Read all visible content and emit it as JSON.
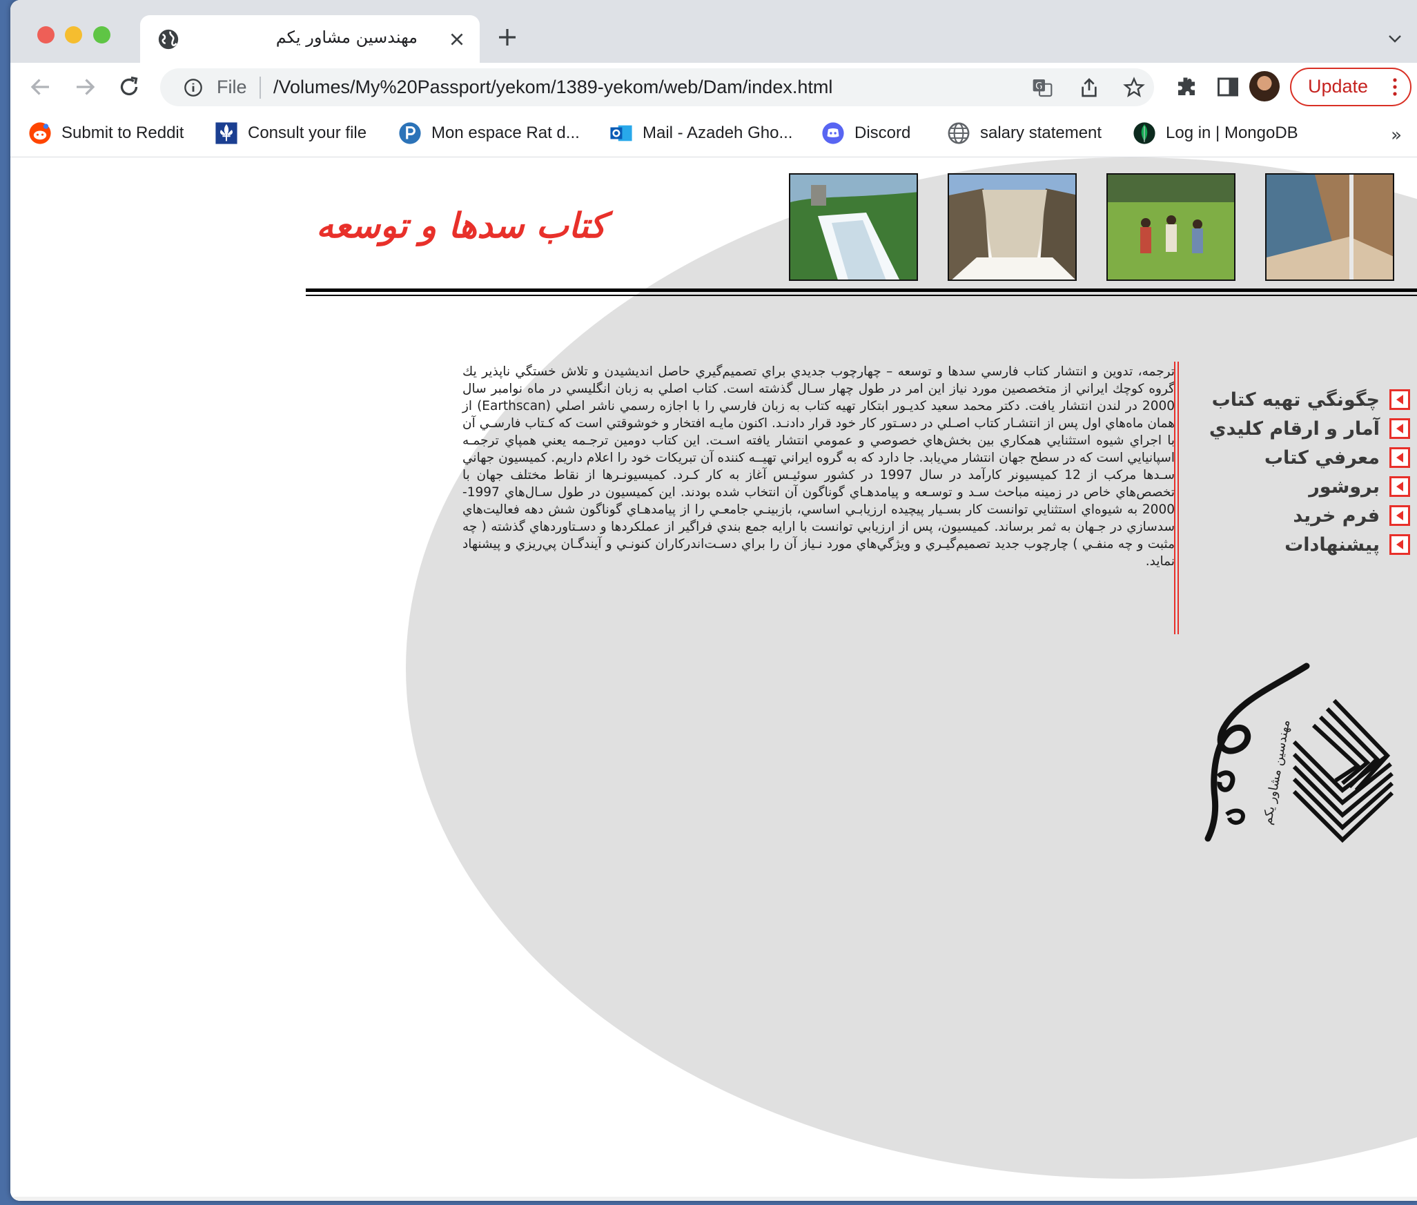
{
  "browser": {
    "tab": {
      "title": "مهندسين مشاور يكم"
    },
    "address_bar": {
      "scheme_label": "File",
      "url": "/Volumes/My%20Passport/yekom/1389-yekom/web/Dam/index.html"
    },
    "update_button": {
      "label": "Update"
    },
    "bookmarks": [
      {
        "label": "Submit to Reddit",
        "icon": "reddit-icon"
      },
      {
        "label": "Consult your file",
        "icon": "fleur-de-lis-icon"
      },
      {
        "label": "Mon espace Rat d...",
        "icon": "p-circle-icon"
      },
      {
        "label": "Mail - Azadeh Gho...",
        "icon": "outlook-icon"
      },
      {
        "label": "Discord",
        "icon": "discord-icon"
      },
      {
        "label": "salary statement",
        "icon": "globe-icon"
      },
      {
        "label": "Log in | MongoDB",
        "icon": "mongodb-leaf-icon"
      }
    ],
    "bookmarks_overflow": "»"
  },
  "page": {
    "title": "كتاب سدها و توسعه",
    "article": "ترجمه، تدوين و انتشار كتاب فارسي سدها و توسعه  –  چهارچوب جديدي براي تصميم‌گيري حاصل انديشيدن و تلاش خستگي ناپذير يك گروه كوچك ايراني از متخصصين مورد نياز اين امر در طول چهار سـال گذشته است. كتاب اصلي به زبان انگليسي در ماه نوامبر سال 2000 در لندن انتشار يافت. دكتر محمد سعيد كديـور ابتكار تهيه كتاب به زبان فارسي را با اجازه رسمي ناشر اصلي (Earthscan) از همان ماه‌هاي اول پس از انتشـار كتاب اصـلي در دسـتور كار خود قرار دادنـد. اكنون مايـه افتخار و خوشوقتي است كه كـتاب فارسـي آن با اجراي شيوه استثنايي همكاري بين بخش‌هاي خصوصي و عمومي انتشار يافته اسـت. اين كتاب دومين ترجـمه يعني همپاي ترجمـه اسپانيايي است كه در سطح جهان انتشار مي‌يابد. جا دارد كه به گروه ايراني تهيــه كننده آن تبريكات خود را اعلام داريم. كميسيون جهاني سـدها مركب از 12 كميسيونر كارآمد در سال 1997 در كشور سوئيـس آغاز به كار كـرد.  كميسيونـرها از نقاط مختلف جهان با تخصص‌هاي خاص در زمينه مباحث سـد و توسـعه و پيامدهـاي گوناگون آن انتخاب شده بودند. اين كميسيون در طول سـال‌هاي 1997-2000 به شيوه‌اي استثنايي توانست كار بسـيار پيچيده ارزيابـي اساسي، بازبينـي جامعـي را از پيامدهـاي گوناگون شش دهه فعاليت‌هاي سدسازي در جـهان به ثمر برساند. كميسيون، پس از ارزيابي توانست با ارايه جمع بندي فراگير از عملكردها و دسـتاوردهاي گذشته  ( چه مثبت و چه منفـي ) چارچوب جديد تصميم‌گيـري و ويژگي‌هاي مورد نـياز آن را براي دسـت‌اندركاران كنونـي و آيندگـان پي‌ريزي و پيشنهاد نمايد.",
    "menu": [
      {
        "label": "چگونگي تهيه كتاب"
      },
      {
        "label": "آمار و ارقام كليدي"
      },
      {
        "label": "معرفي كتاب"
      },
      {
        "label": "بروشور"
      },
      {
        "label": "فرم خريد"
      },
      {
        "label": "پيشنهادات"
      }
    ],
    "logo_text": "مهندسين مشاور يكم"
  },
  "colors": {
    "title_red": "#e8302a",
    "arrow_red": "#e8302a",
    "ellipse_gray": "#e0e0e0",
    "update_red": "#c5221f"
  }
}
